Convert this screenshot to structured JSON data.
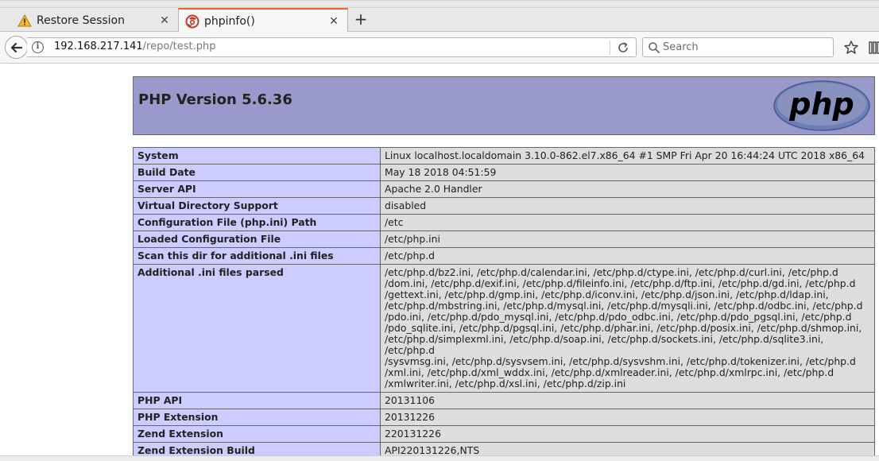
{
  "tabs": [
    {
      "label": "Restore Session",
      "icon": "warning-icon",
      "active": false
    },
    {
      "label": "phpinfo()",
      "icon": "firefox-icon",
      "active": true
    }
  ],
  "new_tab_label": "+",
  "close_glyph": "✕",
  "navbar": {
    "url_host": "192.168.217.141",
    "url_path": "/repo/test.php",
    "search_placeholder": "Search"
  },
  "php": {
    "title": "PHP Version 5.6.36",
    "logo_text": "php",
    "rows": [
      {
        "key": "System",
        "value": "Linux localhost.localdomain 3.10.0-862.el7.x86_64 #1 SMP Fri Apr 20 16:44:24 UTC 2018 x86_64"
      },
      {
        "key": "Build Date",
        "value": "May 18 2018 04:51:59"
      },
      {
        "key": "Server API",
        "value": "Apache 2.0 Handler"
      },
      {
        "key": "Virtual Directory Support",
        "value": "disabled"
      },
      {
        "key": "Configuration File (php.ini) Path",
        "value": "/etc"
      },
      {
        "key": "Loaded Configuration File",
        "value": "/etc/php.ini"
      },
      {
        "key": "Scan this dir for additional .ini files",
        "value": "/etc/php.d"
      },
      {
        "key": "Additional .ini files parsed",
        "value": "/etc/php.d/bz2.ini, /etc/php.d/calendar.ini, /etc/php.d/ctype.ini, /etc/php.d/curl.ini, /etc/php.d\n/dom.ini, /etc/php.d/exif.ini, /etc/php.d/fileinfo.ini, /etc/php.d/ftp.ini, /etc/php.d/gd.ini, /etc/php.d\n/gettext.ini, /etc/php.d/gmp.ini, /etc/php.d/iconv.ini, /etc/php.d/json.ini, /etc/php.d/ldap.ini,\n/etc/php.d/mbstring.ini, /etc/php.d/mysql.ini, /etc/php.d/mysqli.ini, /etc/php.d/odbc.ini, /etc/php.d\n/pdo.ini, /etc/php.d/pdo_mysql.ini, /etc/php.d/pdo_odbc.ini, /etc/php.d/pdo_pgsql.ini, /etc/php.d\n/pdo_sqlite.ini, /etc/php.d/pgsql.ini, /etc/php.d/phar.ini, /etc/php.d/posix.ini, /etc/php.d/shmop.ini,\n/etc/php.d/simplexml.ini, /etc/php.d/soap.ini, /etc/php.d/sockets.ini, /etc/php.d/sqlite3.ini, /etc/php.d\n/sysvmsg.ini, /etc/php.d/sysvsem.ini, /etc/php.d/sysvshm.ini, /etc/php.d/tokenizer.ini, /etc/php.d\n/xml.ini, /etc/php.d/xml_wddx.ini, /etc/php.d/xmlreader.ini, /etc/php.d/xmlrpc.ini, /etc/php.d\n/xmlwriter.ini, /etc/php.d/xsl.ini, /etc/php.d/zip.ini"
      },
      {
        "key": "PHP API",
        "value": "20131106"
      },
      {
        "key": "PHP Extension",
        "value": "20131226"
      },
      {
        "key": "Zend Extension",
        "value": "220131226"
      },
      {
        "key": "Zend Extension Build",
        "value": "API220131226,NTS"
      }
    ]
  },
  "colors": {
    "php_header_bg": "#9999cc",
    "key_cell_bg": "#ccccff",
    "value_cell_bg": "#dddddd",
    "active_tab_accent": "#ec6a23",
    "warning_icon": "#e8a317"
  }
}
